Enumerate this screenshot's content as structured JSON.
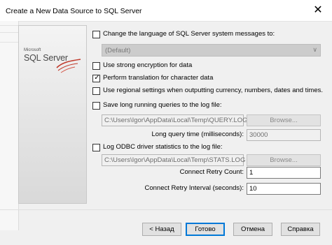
{
  "window": {
    "title": "Create a New Data Source to SQL Server",
    "close_glyph": "✕"
  },
  "logo": {
    "brand_small": "Microsoft",
    "brand": "SQL Server"
  },
  "options": {
    "change_language": {
      "label": "Change the language of SQL Server system messages to:",
      "checked": false
    },
    "language_value": "(Default)",
    "strong_encryption": {
      "label": "Use strong encryption for data",
      "checked": false
    },
    "translation": {
      "label": "Perform translation for character data",
      "checked": true
    },
    "regional_settings": {
      "label": "Use regional settings when outputting currency, numbers, dates and times.",
      "checked": false
    },
    "long_queries": {
      "label": "Save long running queries to the log file:",
      "checked": false
    },
    "query_log_path": "C:\\Users\\Igor\\AppData\\Local\\Temp\\QUERY.LOG",
    "long_query_time_label": "Long query time (milliseconds):",
    "long_query_time_value": "30000",
    "odbc_stats": {
      "label": "Log ODBC driver statistics to the log file:",
      "checked": false
    },
    "stats_log_path": "C:\\Users\\Igor\\AppData\\Local\\Temp\\STATS.LOG",
    "browse_label": "Browse...",
    "retry_count_label": "Connect Retry Count:",
    "retry_count_value": "1",
    "retry_interval_label": "Connect Retry Interval (seconds):",
    "retry_interval_value": "10"
  },
  "buttons": {
    "back": "< Назад",
    "finish": "Готово",
    "cancel": "Отмена",
    "help": "Справка"
  }
}
